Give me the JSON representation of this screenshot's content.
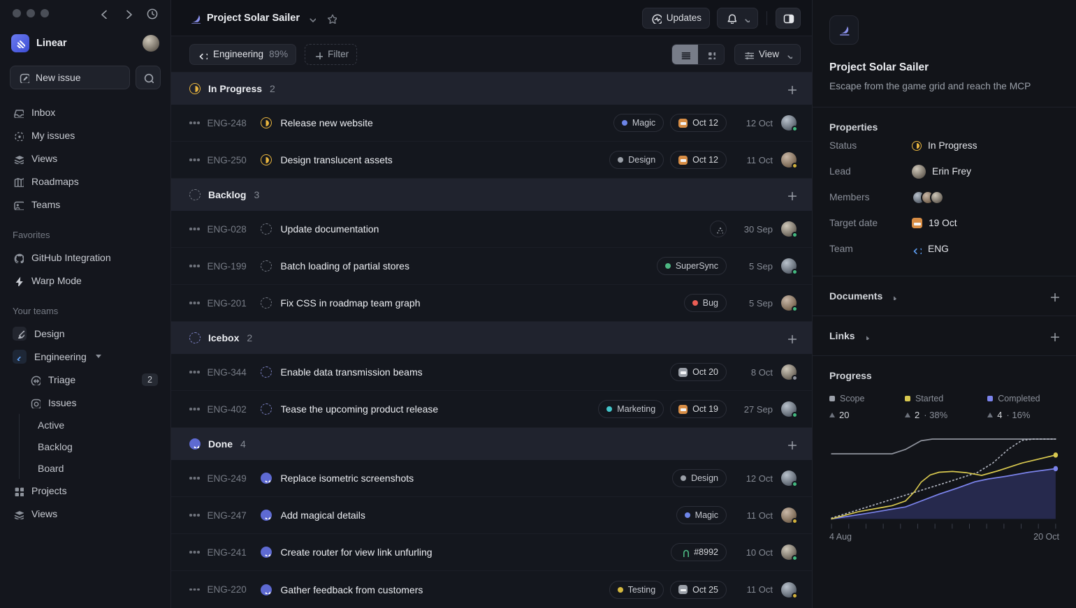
{
  "sidebar": {
    "workspace_name": "Linear",
    "new_issue": "New issue",
    "nav": [
      {
        "icon": "inbox-icon",
        "label": "Inbox"
      },
      {
        "icon": "my-issues-icon",
        "label": "My issues"
      },
      {
        "icon": "views-icon",
        "label": "Views"
      },
      {
        "icon": "roadmaps-icon",
        "label": "Roadmaps"
      },
      {
        "icon": "teams-icon",
        "label": "Teams"
      }
    ],
    "favorites_title": "Favorites",
    "favorites": [
      {
        "icon": "github-icon",
        "label": "GitHub Integration"
      },
      {
        "icon": "lightning-icon",
        "label": "Warp Mode"
      }
    ],
    "teams_title": "Your teams",
    "team_design": "Design",
    "team_engineering": "Engineering",
    "triage_label": "Triage",
    "triage_badge": "2",
    "issues_label": "Issues",
    "issues_sub": {
      "active": "Active",
      "backlog": "Backlog",
      "board": "Board"
    },
    "projects_label": "Projects",
    "views_label": "Views"
  },
  "header": {
    "project_title": "Project Solar Sailer",
    "updates_label": "Updates"
  },
  "filter_bar": {
    "team_name": "Engineering",
    "team_percent": "89%",
    "filter_label": "Filter",
    "view_label": "View"
  },
  "sections": [
    {
      "name": "In Progress",
      "count": "2",
      "rows": [
        {
          "id": "ENG-248",
          "title": "Release new website",
          "label": {
            "text": "Magic",
            "color": "#6d85e8"
          },
          "due": {
            "text": "Oct 12",
            "color": "#d78d45"
          },
          "date": "12 Oct"
        },
        {
          "id": "ENG-250",
          "title": "Design translucent assets",
          "label": {
            "text": "Design",
            "color": "#9ba0a8"
          },
          "due": {
            "text": "Oct 12",
            "color": "#d78d45"
          },
          "date": "11 Oct"
        }
      ]
    },
    {
      "name": "Backlog",
      "count": "3",
      "rows": [
        {
          "id": "ENG-028",
          "title": "Update documentation",
          "date": "30 Sep"
        },
        {
          "id": "ENG-199",
          "title": "Batch loading of partial stores",
          "label": {
            "text": "SuperSync",
            "color": "#4cb782"
          },
          "date": "5 Sep"
        },
        {
          "id": "ENG-201",
          "title": "Fix CSS in roadmap team graph",
          "label": {
            "text": "Bug",
            "color": "#eb5e55"
          },
          "date": "5 Sep"
        }
      ]
    },
    {
      "name": "Icebox",
      "count": "2",
      "rows": [
        {
          "id": "ENG-344",
          "title": "Enable data transmission beams",
          "due": {
            "text": "Oct 20",
            "color": "#9ba0a8"
          },
          "date": "8 Oct"
        },
        {
          "id": "ENG-402",
          "title": "Tease the upcoming product release",
          "label": {
            "text": "Marketing",
            "color": "#43c5ca"
          },
          "due": {
            "text": "Oct 19",
            "color": "#d78d45"
          },
          "date": "27 Sep"
        }
      ]
    },
    {
      "name": "Done",
      "count": "4",
      "rows": [
        {
          "id": "ENG-249",
          "title": "Replace isometric screenshots",
          "label": {
            "text": "Design",
            "color": "#9ba0a8"
          },
          "date": "12 Oct"
        },
        {
          "id": "ENG-247",
          "title": "Add magical details",
          "label": {
            "text": "Magic",
            "color": "#6d85e8"
          },
          "date": "11 Oct"
        },
        {
          "id": "ENG-241",
          "title": "Create router for view link unfurling",
          "pr": {
            "text": "#8992",
            "color": "#4cb782"
          },
          "date": "10 Oct"
        },
        {
          "id": "ENG-220",
          "title": "Gather feedback from customers",
          "label": {
            "text": "Testing",
            "color": "#d5b93f"
          },
          "due": {
            "text": "Oct 25",
            "color": "#9ba0a8"
          },
          "date": "11 Oct"
        }
      ]
    }
  ],
  "panel": {
    "title": "Project Solar Sailer",
    "description": "Escape from the game grid and reach the MCP",
    "properties_title": "Properties",
    "status_label": "Status",
    "status_value": "In Progress",
    "lead_label": "Lead",
    "lead_value": "Erin Frey",
    "members_label": "Members",
    "target_label": "Target date",
    "target_value": "19 Oct",
    "team_label": "Team",
    "team_value": "ENG",
    "documents_title": "Documents",
    "links_title": "Links",
    "progress_title": "Progress"
  },
  "chart_data": {
    "type": "line",
    "title": "Project progress burn-up",
    "x_start_label": "4 Aug",
    "x_end_label": "20 Oct",
    "ylim": [
      0,
      20
    ],
    "tick_count": 14,
    "grid": false,
    "legend_position": "top",
    "legend": [
      {
        "name": "Scope",
        "color": "#9ca1aa",
        "count": "20",
        "pct": ""
      },
      {
        "name": "Started",
        "color": "#d8c84f",
        "count": "2",
        "pct": "· 38%"
      },
      {
        "name": "Completed",
        "color": "#7b83eb",
        "count": "4",
        "pct": "· 16%"
      }
    ],
    "series": [
      {
        "name": "Completed-area",
        "color": "#7b83eb",
        "area": true,
        "area_color": "rgba(97,106,229,0.26)",
        "line": false,
        "points": [
          [
            0,
            0
          ],
          [
            0.17,
            1.5
          ],
          [
            0.33,
            3
          ],
          [
            0.4,
            4.5
          ],
          [
            0.48,
            6.2
          ],
          [
            0.56,
            7.7
          ],
          [
            0.64,
            9.3
          ],
          [
            0.7,
            10
          ],
          [
            0.78,
            10.7
          ],
          [
            0.88,
            11.7
          ],
          [
            1,
            12.6
          ]
        ]
      },
      {
        "name": "Scope",
        "color": "#8f939d",
        "points": [
          [
            0,
            16.3
          ],
          [
            0.27,
            16.3
          ],
          [
            0.33,
            17.4
          ],
          [
            0.4,
            19.6
          ],
          [
            0.45,
            20
          ],
          [
            1,
            20
          ]
        ]
      },
      {
        "name": "Ideal",
        "color": "#aeb2bd",
        "style": "dotted",
        "points": [
          [
            0,
            0.2
          ],
          [
            0.5,
            8.9
          ],
          [
            0.65,
            11.6
          ],
          [
            0.72,
            14
          ],
          [
            0.79,
            17.5
          ],
          [
            0.85,
            19.7
          ],
          [
            0.9,
            20
          ],
          [
            1,
            20
          ]
        ]
      },
      {
        "name": "Completed",
        "color": "#7b83eb",
        "end_dot": true,
        "points": [
          [
            0,
            0
          ],
          [
            0.17,
            1.5
          ],
          [
            0.33,
            3
          ],
          [
            0.4,
            4.5
          ],
          [
            0.48,
            6.2
          ],
          [
            0.56,
            7.7
          ],
          [
            0.64,
            9.3
          ],
          [
            0.7,
            10
          ],
          [
            0.78,
            10.7
          ],
          [
            0.88,
            11.7
          ],
          [
            1,
            12.6
          ]
        ]
      },
      {
        "name": "Started",
        "color": "#d8c84f",
        "end_dot": true,
        "points": [
          [
            0,
            0
          ],
          [
            0.12,
            1.8
          ],
          [
            0.27,
            3.3
          ],
          [
            0.33,
            4.5
          ],
          [
            0.37,
            6.8
          ],
          [
            0.4,
            9.2
          ],
          [
            0.44,
            11
          ],
          [
            0.48,
            11.7
          ],
          [
            0.54,
            11.9
          ],
          [
            0.6,
            11.6
          ],
          [
            0.67,
            10.9
          ],
          [
            0.74,
            12
          ],
          [
            0.85,
            14
          ],
          [
            1,
            16
          ]
        ]
      }
    ]
  },
  "colors": {
    "accent_in_progress": "#e9b53f",
    "accent_done": "#5e6ad2",
    "accent_icebox": "#7b80c2",
    "accent_backlog": "#737883",
    "team_blue": "#5c9df2",
    "calendar_orange": "#d78d45",
    "calendar_gray": "#9ba0a8"
  }
}
